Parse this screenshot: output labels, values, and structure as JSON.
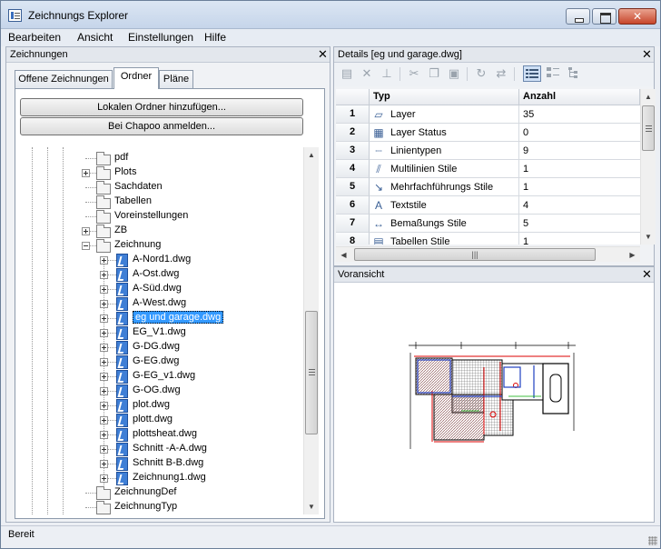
{
  "window": {
    "title": "Zeichnungs Explorer"
  },
  "menu": [
    "Bearbeiten",
    "Ansicht",
    "Einstellungen",
    "Hilfe"
  ],
  "left_panel": {
    "title": "Zeichnungen",
    "close": "✕",
    "tabs": [
      "Offene Zeichnungen",
      "Ordner",
      "Pläne"
    ],
    "active_tab": "Ordner",
    "buttons": [
      "Lokalen Ordner hinzufügen...",
      "Bei Chapoo anmelden..."
    ],
    "tree": [
      {
        "label": "pdf",
        "type": "folder",
        "expander": "none",
        "selected": false
      },
      {
        "label": "Plots",
        "type": "folder",
        "expander": "plus",
        "selected": false
      },
      {
        "label": "Sachdaten",
        "type": "folder",
        "expander": "none",
        "selected": false
      },
      {
        "label": "Tabellen",
        "type": "folder",
        "expander": "none",
        "selected": false
      },
      {
        "label": "Voreinstellungen",
        "type": "folder",
        "expander": "none",
        "selected": false
      },
      {
        "label": "ZB",
        "type": "folder",
        "expander": "plus",
        "selected": false
      },
      {
        "label": "Zeichnung",
        "type": "folder-open",
        "expander": "minus",
        "selected": false
      },
      {
        "label": "A-Nord1.dwg",
        "type": "dwg",
        "expander": "plus",
        "selected": false
      },
      {
        "label": "A-Ost.dwg",
        "type": "dwg",
        "expander": "plus",
        "selected": false
      },
      {
        "label": "A-Süd.dwg",
        "type": "dwg",
        "expander": "plus",
        "selected": false
      },
      {
        "label": "A-West.dwg",
        "type": "dwg",
        "expander": "plus",
        "selected": false
      },
      {
        "label": "eg und garage.dwg",
        "type": "dwg",
        "expander": "plus",
        "selected": true
      },
      {
        "label": "EG_V1.dwg",
        "type": "dwg",
        "expander": "plus",
        "selected": false
      },
      {
        "label": "G-DG.dwg",
        "type": "dwg",
        "expander": "plus",
        "selected": false
      },
      {
        "label": "G-EG.dwg",
        "type": "dwg",
        "expander": "plus",
        "selected": false
      },
      {
        "label": "G-EG_v1.dwg",
        "type": "dwg",
        "expander": "plus",
        "selected": false
      },
      {
        "label": "G-OG.dwg",
        "type": "dwg",
        "expander": "plus",
        "selected": false
      },
      {
        "label": "plot.dwg",
        "type": "dwg",
        "expander": "plus",
        "selected": false
      },
      {
        "label": "plott.dwg",
        "type": "dwg",
        "expander": "plus",
        "selected": false
      },
      {
        "label": "plottsheat.dwg",
        "type": "dwg",
        "expander": "plus",
        "selected": false
      },
      {
        "label": "Schnitt -A-A.dwg",
        "type": "dwg",
        "expander": "plus",
        "selected": false
      },
      {
        "label": "Schnitt B-B.dwg",
        "type": "dwg",
        "expander": "plus",
        "selected": false
      },
      {
        "label": "Zeichnung1.dwg",
        "type": "dwg",
        "expander": "plus",
        "selected": false
      },
      {
        "label": "ZeichnungDef",
        "type": "folder",
        "expander": "none",
        "selected": false
      },
      {
        "label": "ZeichnungTyp",
        "type": "folder",
        "expander": "none",
        "selected": false
      }
    ]
  },
  "details_panel": {
    "title": "Details [eg und garage.dwg]",
    "close": "✕",
    "columns": [
      "Typ",
      "Anzahl"
    ],
    "rows": [
      {
        "num": "1",
        "type": "Layer",
        "count": "35",
        "icon": "layer-icon"
      },
      {
        "num": "2",
        "type": "Layer Status",
        "count": "0",
        "icon": "layer-status-icon"
      },
      {
        "num": "3",
        "type": "Linientypen",
        "count": "9",
        "icon": "linetype-icon"
      },
      {
        "num": "4",
        "type": "Multilinien Stile",
        "count": "1",
        "icon": "multiline-icon"
      },
      {
        "num": "5",
        "type": "Mehrfachführungs Stile",
        "count": "1",
        "icon": "multileader-icon"
      },
      {
        "num": "6",
        "type": "Textstile",
        "count": "4",
        "icon": "textstyle-icon"
      },
      {
        "num": "7",
        "type": "Bemaßungs Stile",
        "count": "5",
        "icon": "dimstyle-icon"
      },
      {
        "num": "8",
        "type": "Tabellen Stile",
        "count": "1",
        "icon": "tablestyle-icon"
      }
    ]
  },
  "preview_panel": {
    "title": "Voransicht",
    "close": "✕"
  },
  "statusbar": {
    "text": "Bereit"
  },
  "icons": {
    "toolbar": [
      "import-icon",
      "delete-icon",
      "pin-icon",
      "cut-icon",
      "copy-icon",
      "paste-icon",
      "refresh-icon",
      "sync-icon",
      "details-view-icon",
      "list-view-icon",
      "tree-view-icon"
    ]
  },
  "colors": {
    "selection": "#3399ff",
    "window_bg": "#eceff4"
  }
}
